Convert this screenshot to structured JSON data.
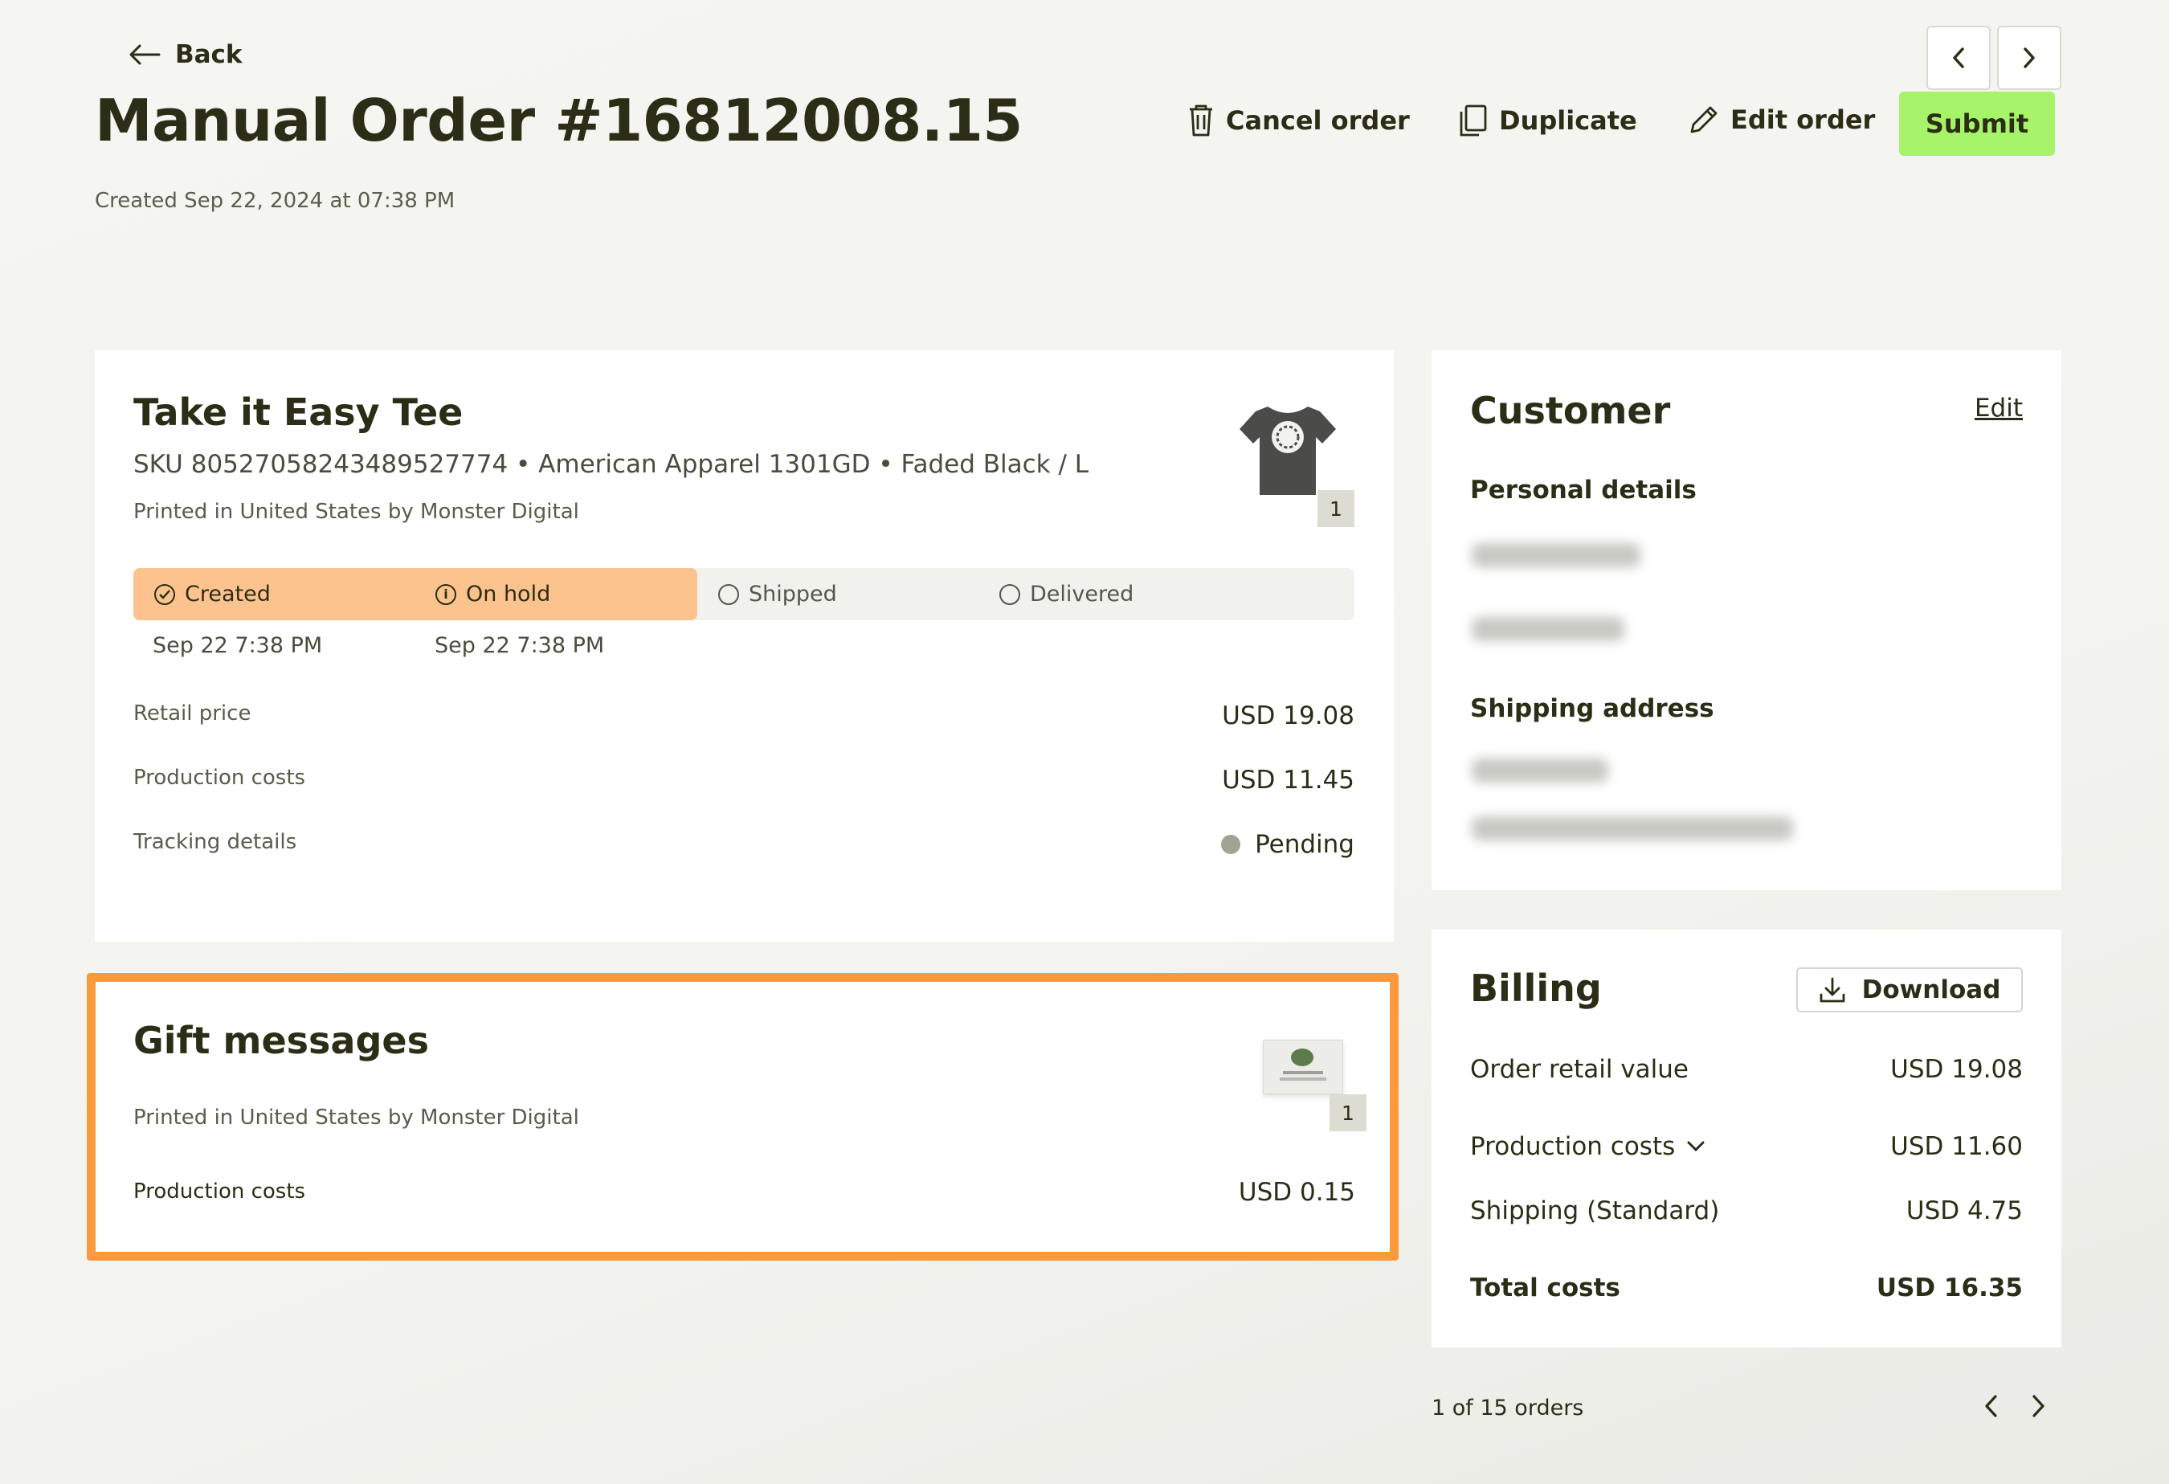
{
  "header": {
    "back_label": "Back",
    "title": "Manual Order #16812008.15",
    "created": "Created Sep 22, 2024 at 07:38 PM",
    "actions": {
      "cancel": "Cancel order",
      "duplicate": "Duplicate",
      "edit": "Edit order",
      "submit": "Submit"
    }
  },
  "product": {
    "name": "Take it Easy Tee",
    "sku_line": "SKU 80527058243489527774  • American Apparel 1301GD • Faded Black / L",
    "printed": "Printed in United States by Monster Digital",
    "quantity": "1",
    "steps": [
      {
        "label": "Created",
        "date": "Sep 22 7:38 PM",
        "state": "done"
      },
      {
        "label": "On hold",
        "date": "Sep 22 7:38 PM",
        "state": "info"
      },
      {
        "label": "Shipped",
        "date": "",
        "state": "pending"
      },
      {
        "label": "Delivered",
        "date": "",
        "state": "pending"
      }
    ],
    "rows": [
      {
        "label": "Retail price",
        "value": "USD 19.08"
      },
      {
        "label": "Production costs",
        "value": "USD 11.45"
      },
      {
        "label": "Tracking details",
        "value": "Pending"
      }
    ],
    "status_dot_color": "#a1a393"
  },
  "gift": {
    "title": "Gift messages",
    "printed": "Printed in United States by Monster Digital",
    "quantity": "1",
    "cost_label": "Production costs",
    "cost_value": "USD 0.15"
  },
  "customer": {
    "title": "Customer",
    "edit": "Edit",
    "personal_details": "Personal details",
    "shipping_address": "Shipping address"
  },
  "billing": {
    "title": "Billing",
    "download": "Download",
    "rows": [
      {
        "label": "Order retail value",
        "value": "USD 19.08"
      },
      {
        "label": "Production costs",
        "value": "USD 11.60"
      },
      {
        "label": "Shipping (Standard)",
        "value": "USD 4.75"
      }
    ],
    "total_label": "Total costs",
    "total_value": "USD 16.35"
  },
  "pagination": {
    "text": "1 of 15 orders"
  },
  "colors": {
    "accent_green": "#a7f46a",
    "progress_orange": "#fdc38f",
    "highlight_orange": "#fb9a3d",
    "text_dark": "#2b2d16"
  }
}
